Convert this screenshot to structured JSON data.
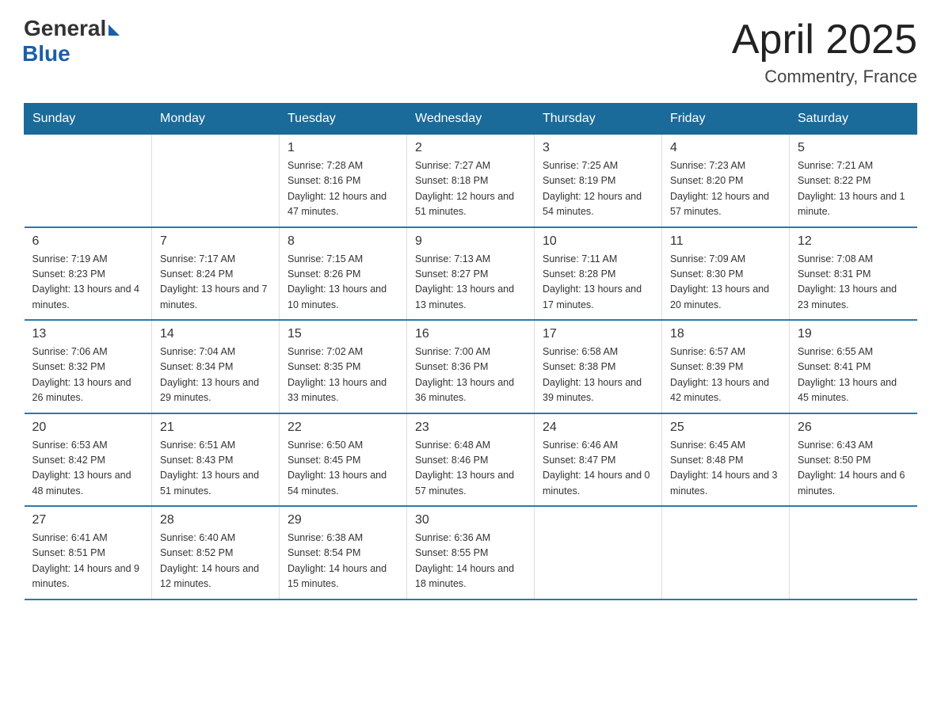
{
  "header": {
    "logo_general": "General",
    "logo_blue": "Blue",
    "month_title": "April 2025",
    "location": "Commentry, France"
  },
  "days_of_week": [
    "Sunday",
    "Monday",
    "Tuesday",
    "Wednesday",
    "Thursday",
    "Friday",
    "Saturday"
  ],
  "weeks": [
    [
      {
        "day": "",
        "info": ""
      },
      {
        "day": "",
        "info": ""
      },
      {
        "day": "1",
        "info": "Sunrise: 7:28 AM\nSunset: 8:16 PM\nDaylight: 12 hours\nand 47 minutes."
      },
      {
        "day": "2",
        "info": "Sunrise: 7:27 AM\nSunset: 8:18 PM\nDaylight: 12 hours\nand 51 minutes."
      },
      {
        "day": "3",
        "info": "Sunrise: 7:25 AM\nSunset: 8:19 PM\nDaylight: 12 hours\nand 54 minutes."
      },
      {
        "day": "4",
        "info": "Sunrise: 7:23 AM\nSunset: 8:20 PM\nDaylight: 12 hours\nand 57 minutes."
      },
      {
        "day": "5",
        "info": "Sunrise: 7:21 AM\nSunset: 8:22 PM\nDaylight: 13 hours\nand 1 minute."
      }
    ],
    [
      {
        "day": "6",
        "info": "Sunrise: 7:19 AM\nSunset: 8:23 PM\nDaylight: 13 hours\nand 4 minutes."
      },
      {
        "day": "7",
        "info": "Sunrise: 7:17 AM\nSunset: 8:24 PM\nDaylight: 13 hours\nand 7 minutes."
      },
      {
        "day": "8",
        "info": "Sunrise: 7:15 AM\nSunset: 8:26 PM\nDaylight: 13 hours\nand 10 minutes."
      },
      {
        "day": "9",
        "info": "Sunrise: 7:13 AM\nSunset: 8:27 PM\nDaylight: 13 hours\nand 13 minutes."
      },
      {
        "day": "10",
        "info": "Sunrise: 7:11 AM\nSunset: 8:28 PM\nDaylight: 13 hours\nand 17 minutes."
      },
      {
        "day": "11",
        "info": "Sunrise: 7:09 AM\nSunset: 8:30 PM\nDaylight: 13 hours\nand 20 minutes."
      },
      {
        "day": "12",
        "info": "Sunrise: 7:08 AM\nSunset: 8:31 PM\nDaylight: 13 hours\nand 23 minutes."
      }
    ],
    [
      {
        "day": "13",
        "info": "Sunrise: 7:06 AM\nSunset: 8:32 PM\nDaylight: 13 hours\nand 26 minutes."
      },
      {
        "day": "14",
        "info": "Sunrise: 7:04 AM\nSunset: 8:34 PM\nDaylight: 13 hours\nand 29 minutes."
      },
      {
        "day": "15",
        "info": "Sunrise: 7:02 AM\nSunset: 8:35 PM\nDaylight: 13 hours\nand 33 minutes."
      },
      {
        "day": "16",
        "info": "Sunrise: 7:00 AM\nSunset: 8:36 PM\nDaylight: 13 hours\nand 36 minutes."
      },
      {
        "day": "17",
        "info": "Sunrise: 6:58 AM\nSunset: 8:38 PM\nDaylight: 13 hours\nand 39 minutes."
      },
      {
        "day": "18",
        "info": "Sunrise: 6:57 AM\nSunset: 8:39 PM\nDaylight: 13 hours\nand 42 minutes."
      },
      {
        "day": "19",
        "info": "Sunrise: 6:55 AM\nSunset: 8:41 PM\nDaylight: 13 hours\nand 45 minutes."
      }
    ],
    [
      {
        "day": "20",
        "info": "Sunrise: 6:53 AM\nSunset: 8:42 PM\nDaylight: 13 hours\nand 48 minutes."
      },
      {
        "day": "21",
        "info": "Sunrise: 6:51 AM\nSunset: 8:43 PM\nDaylight: 13 hours\nand 51 minutes."
      },
      {
        "day": "22",
        "info": "Sunrise: 6:50 AM\nSunset: 8:45 PM\nDaylight: 13 hours\nand 54 minutes."
      },
      {
        "day": "23",
        "info": "Sunrise: 6:48 AM\nSunset: 8:46 PM\nDaylight: 13 hours\nand 57 minutes."
      },
      {
        "day": "24",
        "info": "Sunrise: 6:46 AM\nSunset: 8:47 PM\nDaylight: 14 hours\nand 0 minutes."
      },
      {
        "day": "25",
        "info": "Sunrise: 6:45 AM\nSunset: 8:48 PM\nDaylight: 14 hours\nand 3 minutes."
      },
      {
        "day": "26",
        "info": "Sunrise: 6:43 AM\nSunset: 8:50 PM\nDaylight: 14 hours\nand 6 minutes."
      }
    ],
    [
      {
        "day": "27",
        "info": "Sunrise: 6:41 AM\nSunset: 8:51 PM\nDaylight: 14 hours\nand 9 minutes."
      },
      {
        "day": "28",
        "info": "Sunrise: 6:40 AM\nSunset: 8:52 PM\nDaylight: 14 hours\nand 12 minutes."
      },
      {
        "day": "29",
        "info": "Sunrise: 6:38 AM\nSunset: 8:54 PM\nDaylight: 14 hours\nand 15 minutes."
      },
      {
        "day": "30",
        "info": "Sunrise: 6:36 AM\nSunset: 8:55 PM\nDaylight: 14 hours\nand 18 minutes."
      },
      {
        "day": "",
        "info": ""
      },
      {
        "day": "",
        "info": ""
      },
      {
        "day": "",
        "info": ""
      }
    ]
  ]
}
